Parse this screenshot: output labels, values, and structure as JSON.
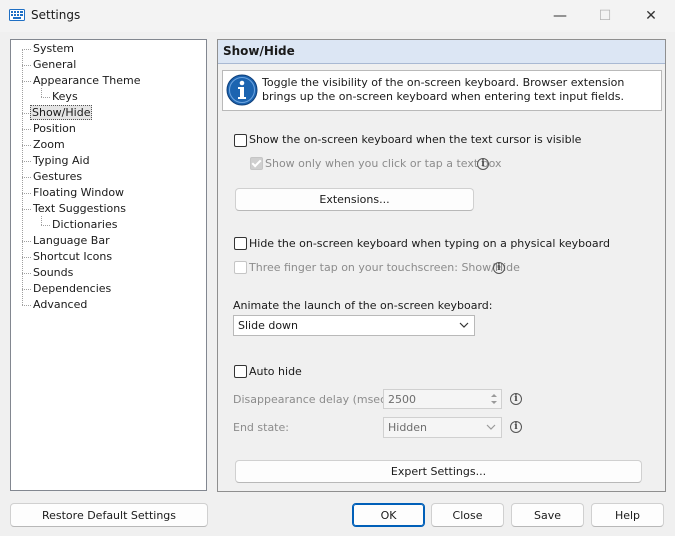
{
  "window": {
    "title": "Settings",
    "min_glyph": "—",
    "max_glyph": "☐",
    "close_glyph": "✕"
  },
  "tree": {
    "items": [
      {
        "label": "System"
      },
      {
        "label": "General"
      },
      {
        "label": "Appearance Theme"
      },
      {
        "label": "Keys"
      },
      {
        "label": "Show/Hide"
      },
      {
        "label": "Position"
      },
      {
        "label": "Zoom"
      },
      {
        "label": "Typing Aid"
      },
      {
        "label": "Gestures"
      },
      {
        "label": "Floating Window"
      },
      {
        "label": "Text Suggestions"
      },
      {
        "label": "Dictionaries"
      },
      {
        "label": "Language Bar"
      },
      {
        "label": "Shortcut Icons"
      },
      {
        "label": "Sounds"
      },
      {
        "label": "Dependencies"
      },
      {
        "label": "Advanced"
      }
    ],
    "selected": "Show/Hide"
  },
  "panel": {
    "title": "Show/Hide",
    "info_text": "Toggle the visibility of the on-screen keyboard. Browser extension brings up the on-screen keyboard when entering text input fields.",
    "show_on_cursor": {
      "label": "Show the on-screen keyboard when the text cursor is visible",
      "checked": false
    },
    "show_on_click": {
      "label": "Show only when you click or tap a text box",
      "checked": true,
      "disabled": true
    },
    "extensions_button": "Extensions...",
    "hide_on_physical": {
      "label": "Hide the on-screen keyboard when typing on a physical keyboard",
      "checked": false
    },
    "three_finger": {
      "label": "Three finger tap on your touchscreen: Show/Hide",
      "checked": false,
      "disabled": true
    },
    "animate_label": "Animate the launch of the on-screen keyboard:",
    "animate_value": "Slide down",
    "auto_hide": {
      "label": "Auto hide",
      "checked": false
    },
    "delay_label": "Disappearance delay (msec):",
    "delay_value": "2500",
    "end_state_label": "End state:",
    "end_state_value": "Hidden",
    "expert_button": "Expert Settings..."
  },
  "footer": {
    "restore": "Restore Default Settings",
    "ok": "OK",
    "close": "Close",
    "save": "Save",
    "help": "Help"
  },
  "colors": {
    "accent": "#005fb8",
    "header_bg": "#dce6f4",
    "info_icon": "#1c64b0"
  },
  "icons": {
    "app": "keyboard-icon",
    "info": "info-icon",
    "chevron": "chevron-down-icon"
  }
}
